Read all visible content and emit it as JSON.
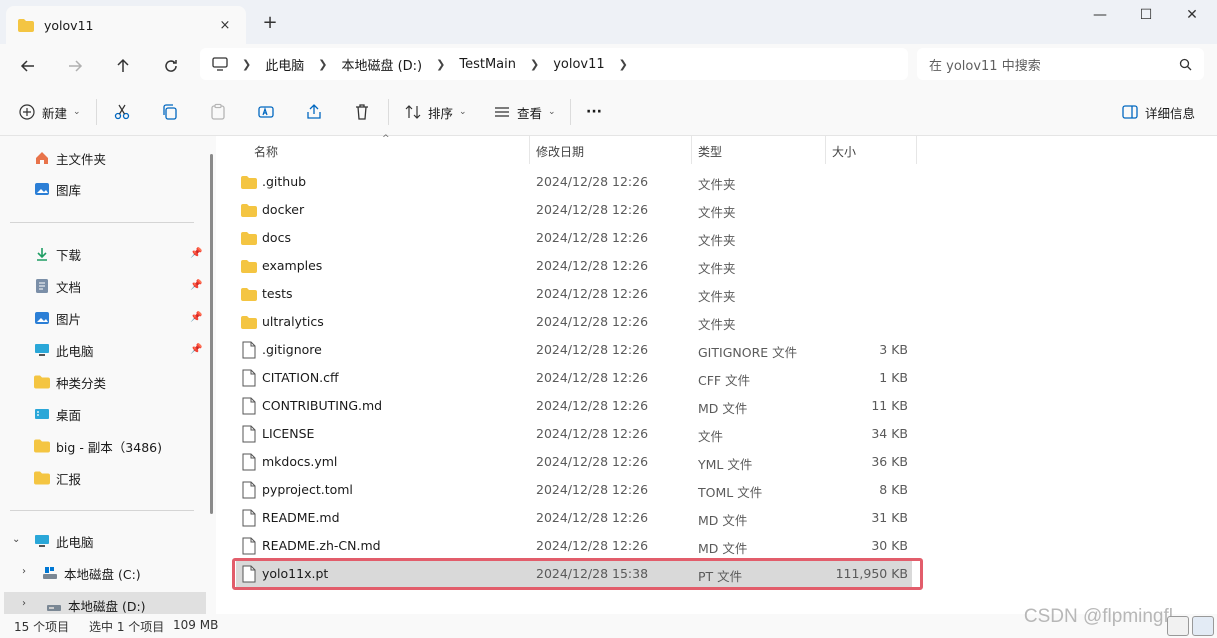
{
  "window": {
    "tab_title": "yolov11",
    "tab_close_icon": "×",
    "new_tab_icon": "+",
    "minimize": "—",
    "maximize": "☐",
    "close": "✕"
  },
  "address": {
    "crumbs": [
      "此电脑",
      "本地磁盘 (D:)",
      "TestMain",
      "yolov11"
    ],
    "search_placeholder": "在 yolov11 中搜索"
  },
  "toolbar": {
    "new_label": "新建",
    "sort_label": "排序",
    "view_label": "查看",
    "more_label": "···",
    "details_label": "详细信息"
  },
  "sidebar": {
    "items": [
      {
        "label": "主文件夹",
        "icon": "home-icon"
      },
      {
        "label": "图库",
        "icon": "gallery-icon"
      },
      {
        "label": "下载",
        "icon": "download-icon",
        "pinned": true
      },
      {
        "label": "文档",
        "icon": "document-icon",
        "pinned": true
      },
      {
        "label": "图片",
        "icon": "picture-icon",
        "pinned": true
      },
      {
        "label": "此电脑",
        "icon": "computer-icon",
        "pinned": true
      },
      {
        "label": "种类分类",
        "icon": "folder-icon"
      },
      {
        "label": "桌面",
        "icon": "desktop-icon"
      },
      {
        "label": "big - 副本（3486)",
        "icon": "folder-icon"
      },
      {
        "label": "汇报",
        "icon": "folder-icon"
      },
      {
        "label": "此电脑",
        "icon": "computer-icon"
      },
      {
        "label": "本地磁盘 (C:)",
        "icon": "drive-icon"
      },
      {
        "label": "本地磁盘 (D:)",
        "icon": "drive-icon"
      }
    ]
  },
  "columns": {
    "name": "名称",
    "date": "修改日期",
    "type": "类型",
    "size": "大小"
  },
  "files": [
    {
      "name": ".github",
      "date": "2024/12/28 12:26",
      "type": "文件夹",
      "size": "",
      "kind": "folder"
    },
    {
      "name": "docker",
      "date": "2024/12/28 12:26",
      "type": "文件夹",
      "size": "",
      "kind": "folder"
    },
    {
      "name": "docs",
      "date": "2024/12/28 12:26",
      "type": "文件夹",
      "size": "",
      "kind": "folder"
    },
    {
      "name": "examples",
      "date": "2024/12/28 12:26",
      "type": "文件夹",
      "size": "",
      "kind": "folder"
    },
    {
      "name": "tests",
      "date": "2024/12/28 12:26",
      "type": "文件夹",
      "size": "",
      "kind": "folder"
    },
    {
      "name": "ultralytics",
      "date": "2024/12/28 12:26",
      "type": "文件夹",
      "size": "",
      "kind": "folder"
    },
    {
      "name": ".gitignore",
      "date": "2024/12/28 12:26",
      "type": "GITIGNORE 文件",
      "size": "3 KB",
      "kind": "file"
    },
    {
      "name": "CITATION.cff",
      "date": "2024/12/28 12:26",
      "type": "CFF 文件",
      "size": "1 KB",
      "kind": "file"
    },
    {
      "name": "CONTRIBUTING.md",
      "date": "2024/12/28 12:26",
      "type": "MD 文件",
      "size": "11 KB",
      "kind": "file"
    },
    {
      "name": "LICENSE",
      "date": "2024/12/28 12:26",
      "type": "文件",
      "size": "34 KB",
      "kind": "file"
    },
    {
      "name": "mkdocs.yml",
      "date": "2024/12/28 12:26",
      "type": "YML 文件",
      "size": "36 KB",
      "kind": "file"
    },
    {
      "name": "pyproject.toml",
      "date": "2024/12/28 12:26",
      "type": "TOML 文件",
      "size": "8 KB",
      "kind": "file"
    },
    {
      "name": "README.md",
      "date": "2024/12/28 12:26",
      "type": "MD 文件",
      "size": "31 KB",
      "kind": "file"
    },
    {
      "name": "README.zh-CN.md",
      "date": "2024/12/28 12:26",
      "type": "MD 文件",
      "size": "30 KB",
      "kind": "file"
    },
    {
      "name": "yolo11x.pt",
      "date": "2024/12/28 15:38",
      "type": "PT 文件",
      "size": "111,950 KB",
      "kind": "file",
      "selected": true
    }
  ],
  "status": {
    "count": "15 个项目",
    "selection": "选中 1 个项目",
    "size": "109 MB"
  },
  "watermark": "CSDN @flpmingfl",
  "colors": {
    "highlight_border": "#e25d6b",
    "folder": "#f4c542",
    "accent": "#0067c0"
  }
}
